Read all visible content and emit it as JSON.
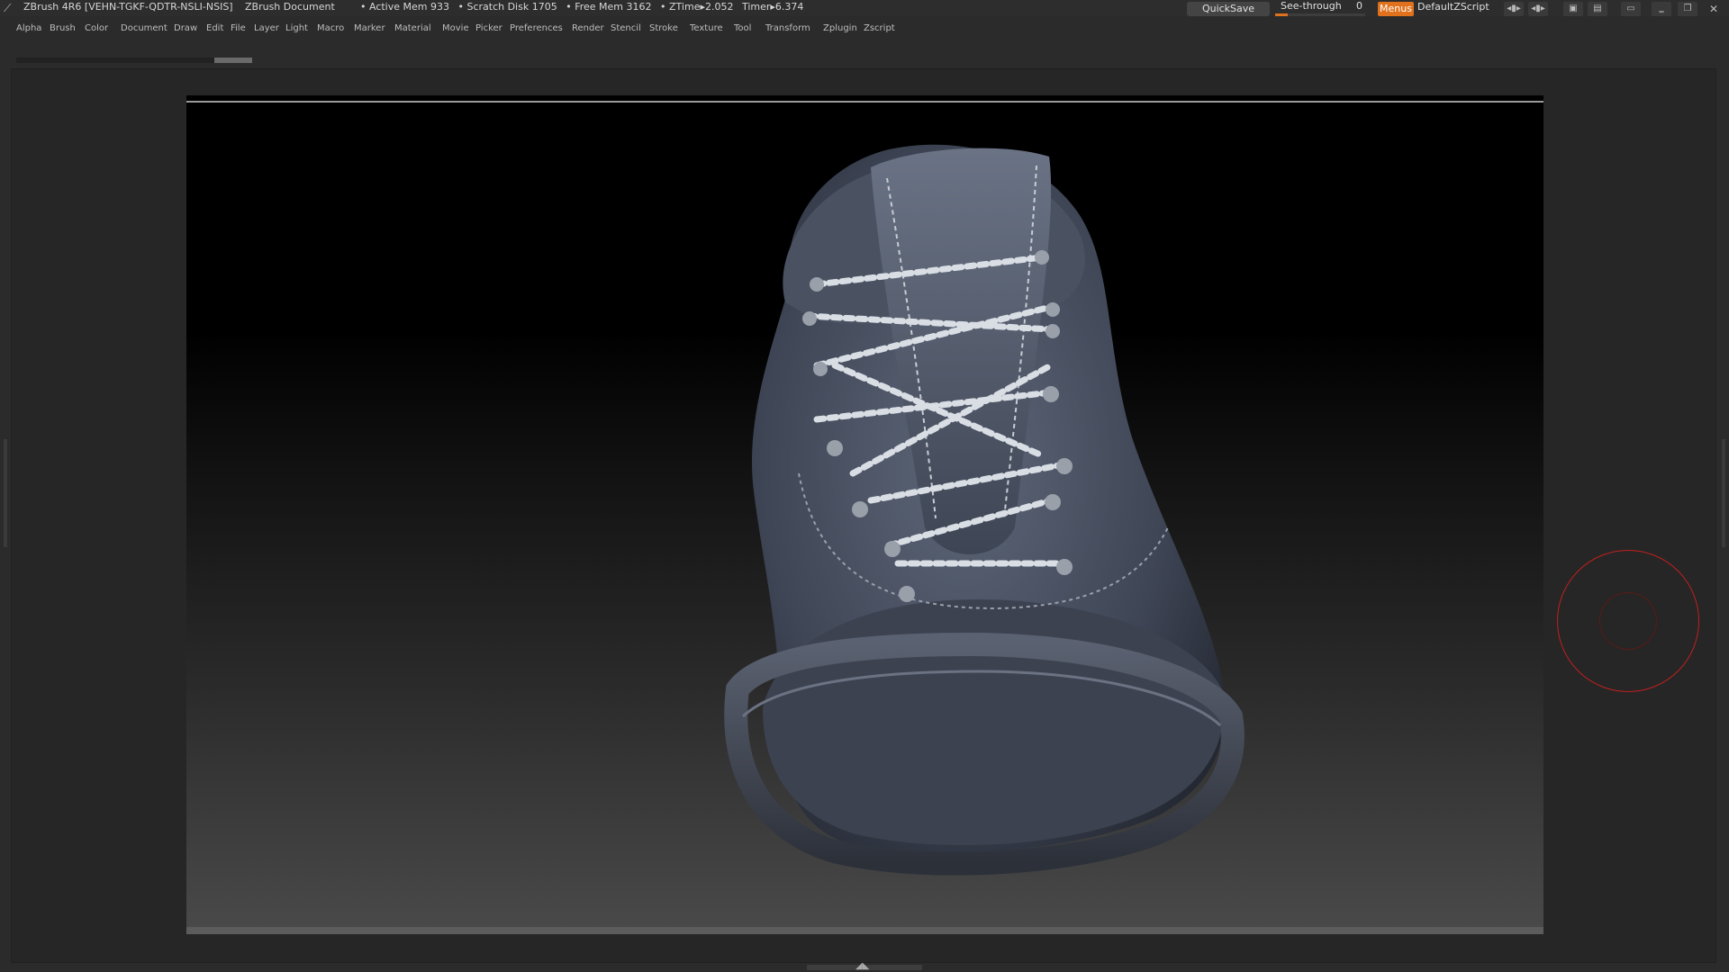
{
  "titlebar": {
    "app_title": "ZBrush 4R6 [VEHN-TGKF-QDTR-NSLI-NSIS]",
    "document_title": "ZBrush Document",
    "stats": [
      "• Active Mem 933",
      "• Scratch Disk 1705",
      "• Free Mem 3162",
      "• ZTime▸2.052",
      "Timer▸6.374"
    ],
    "quicksave_label": "QuickSave",
    "seethrough_label": "See-through",
    "seethrough_value": "0",
    "menus_label": "Menus",
    "script_name": "DefaultZScript"
  },
  "menu": {
    "items": [
      "Alpha",
      "Brush",
      "Color",
      "Document",
      "Draw",
      "Edit",
      "File",
      "Layer",
      "Light",
      "Macro",
      "Marker",
      "Material",
      "Movie",
      "Picker",
      "Preferences",
      "Render",
      "Stencil",
      "Stroke",
      "Texture",
      "Tool",
      "Transform",
      "Zplugin",
      "Zscript"
    ]
  },
  "colors": {
    "accent": "#e0711d",
    "background": "#2b2b2b",
    "cursor_ring": "#c0201e"
  },
  "icons": {
    "logo": "zbrush-logo-icon",
    "window_controls": [
      "minimize-icon",
      "restore-icon",
      "close-icon"
    ]
  }
}
